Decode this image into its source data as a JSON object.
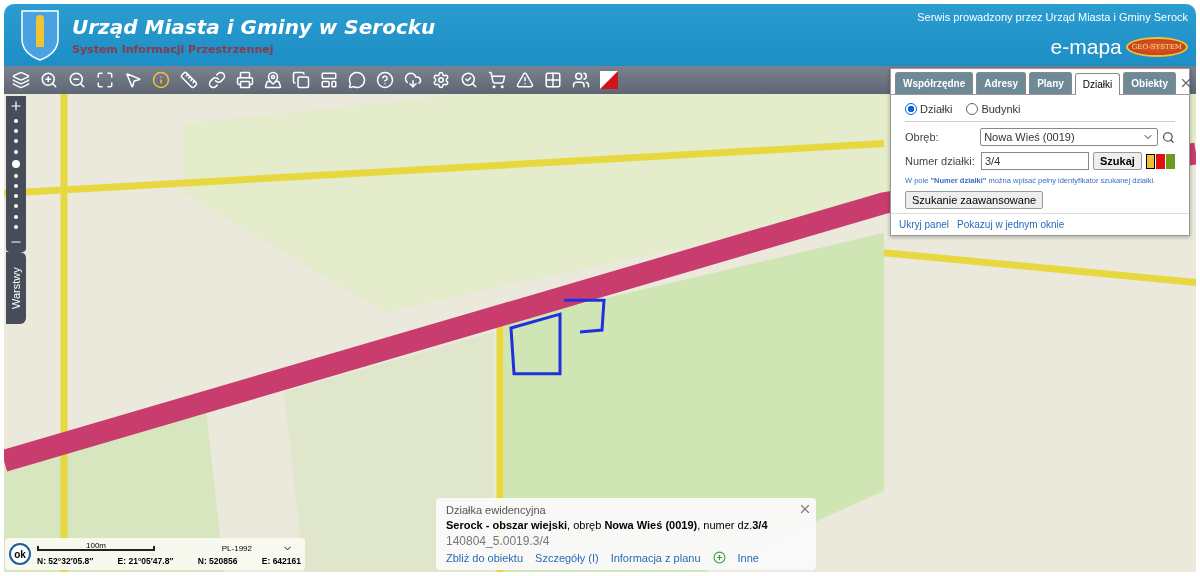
{
  "header": {
    "title": "Urząd Miasta i Gminy w Serocku",
    "subtitle": "System Informacji Przestrzennej",
    "service": "Serwis prowadzony przez Urząd Miasta i Gminy Serock",
    "brand": "e-mapa",
    "brand_badge": "GEO-SYSTEM"
  },
  "zoom": {
    "level": 0.6
  },
  "layers_tab": {
    "label": "Warstwy"
  },
  "panel": {
    "tabs": [
      {
        "label": "Współrzędne",
        "selected": false
      },
      {
        "label": "Adresy",
        "selected": false
      },
      {
        "label": "Plany",
        "selected": false
      },
      {
        "label": "Działki",
        "selected": true
      },
      {
        "label": "Obiekty",
        "selected": false
      }
    ],
    "modes": [
      {
        "label": "Działki",
        "selected": true
      },
      {
        "label": "Budynki",
        "selected": false
      }
    ],
    "precinct": {
      "label": "Obręb:",
      "value": "Nowa Wieś (0019)"
    },
    "parcel": {
      "label": "Numer działki:",
      "value": "3/4"
    },
    "search_button": "Szukaj",
    "swatches": [
      {
        "color": "#f0c030",
        "selected": true
      },
      {
        "color": "#e01010",
        "selected": false
      },
      {
        "color": "#6a9a20",
        "selected": false
      }
    ],
    "hint": "W pole **\"Numer działki\"** można wpisać pełny identyfikator szukanej działki.",
    "advanced_button": "Szukanie zaawansowane",
    "links": [
      "Ukryj panel",
      "Pokazuj w jednym oknie"
    ]
  },
  "info": {
    "heading": "Działka ewidencyjna",
    "description": "**Serock - obszar wiejski**, obręb **Nowa Wieś (0019)**, numer dz.**3/4**",
    "identifier": "140804_5.0019.3/4",
    "links": [
      {
        "label": "Zbliż do obiektu",
        "kind": "link"
      },
      {
        "label": "Szczegóły (I)",
        "kind": "link"
      },
      {
        "label": "Informacja z planu",
        "kind": "link"
      },
      {
        "label": "Inne",
        "kind": "more"
      }
    ]
  },
  "scale": {
    "ok": "ok",
    "distance": "100m",
    "crs": "PL-1992",
    "lat": "N: 52°32′05.8″",
    "lon": "E: 21°05′47.8″",
    "north": "N: 520856",
    "east": "E: 642161"
  }
}
